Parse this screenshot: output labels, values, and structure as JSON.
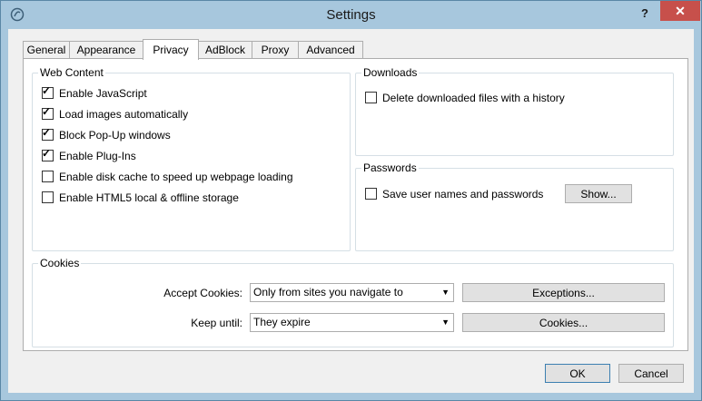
{
  "window": {
    "title": "Settings",
    "help_label": "?",
    "close_label": "✕"
  },
  "tabs": [
    {
      "label": "General"
    },
    {
      "label": "Appearance"
    },
    {
      "label": "Privacy"
    },
    {
      "label": "AdBlock"
    },
    {
      "label": "Proxy"
    },
    {
      "label": "Advanced"
    }
  ],
  "active_tab": "Privacy",
  "web_content": {
    "title": "Web Content",
    "options": [
      {
        "label": "Enable JavaScript",
        "checked": true
      },
      {
        "label": "Load images automatically",
        "checked": true
      },
      {
        "label": "Block Pop-Up windows",
        "checked": true
      },
      {
        "label": "Enable Plug-Ins",
        "checked": true
      },
      {
        "label": "Enable disk cache to speed up webpage loading",
        "checked": false
      },
      {
        "label": "Enable HTML5 local & offline storage",
        "checked": false
      }
    ]
  },
  "downloads": {
    "title": "Downloads",
    "delete_history": {
      "label": "Delete downloaded files with a history",
      "checked": false
    }
  },
  "passwords": {
    "title": "Passwords",
    "save": {
      "label": "Save user names and passwords",
      "checked": false
    },
    "show_button": "Show..."
  },
  "cookies": {
    "title": "Cookies",
    "accept_label": "Accept Cookies:",
    "accept_value": "Only from sites you navigate to",
    "exceptions_button": "Exceptions...",
    "keep_label": "Keep until:",
    "keep_value": "They expire",
    "cookies_button": "Cookies..."
  },
  "footer": {
    "ok": "OK",
    "cancel": "Cancel"
  },
  "colors": {
    "close_button": "#c7504b",
    "frame": "#a7c7dd",
    "default_button_border": "#3c7fb1"
  }
}
